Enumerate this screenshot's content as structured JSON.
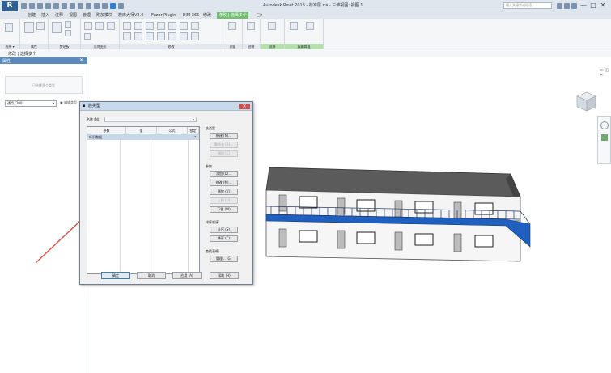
{
  "app": {
    "logo": "R",
    "title": "Autodesk Revit 2016 -    标准层.rfa - 三维视图: 视图 1",
    "search_placeholder": "键入关键字或短语",
    "window_controls": [
      "—",
      "□",
      "✕"
    ]
  },
  "ribbon_tabs": [
    "创建",
    "插入",
    "注释",
    "视图",
    "管理",
    "附加模块",
    "族库大师V2.0",
    "Fuzor Plugin",
    "BIM 365",
    "修改",
    "修改 | 选择多个",
    "□▾"
  ],
  "ribbon_groups": [
    "选择 ▾",
    "属性",
    "剪贴板",
    "几何图形",
    "修改",
    "测量",
    "创建",
    "选择",
    "族编辑器"
  ],
  "option_bar": {
    "label": "修改 | 选择多个"
  },
  "properties": {
    "header": "属性",
    "type_preview": "已选择多个类型",
    "instance_select": "通用 (100)",
    "edit_type": "编辑类型"
  },
  "dialog": {
    "title": "族类型",
    "close_label": "✕",
    "name_label": "名称 (N):",
    "name_value": "",
    "columns": [
      "参数",
      "值",
      "公式",
      "锁定"
    ],
    "group_row": "标识数据",
    "section_family_types": "族类型",
    "btn_new": "新建 (N)...",
    "btn_rename": "重命名 (R)...",
    "btn_delete_type": "删除 (E)",
    "section_params": "参数",
    "btn_add": "添加 (D)...",
    "btn_modify": "修改 (M)...",
    "btn_remove": "删除 (V)",
    "btn_up": "上移 (U)",
    "btn_down": "下移 (W)",
    "section_sort": "排序顺序",
    "btn_ascending": "升序 (S)",
    "btn_descending": "降序 (C)",
    "section_lookup": "查找表格",
    "btn_manage": "管理...  (G)",
    "btn_ok": "确定",
    "btn_cancel": "取消",
    "btn_apply": "应用 (A)",
    "btn_help": "帮助 (H)"
  },
  "colors": {
    "active_tab": "#6fc16d",
    "balcony": "#1f5fbf",
    "annotation_arrow": "#e0483c",
    "roof": "#595959"
  }
}
